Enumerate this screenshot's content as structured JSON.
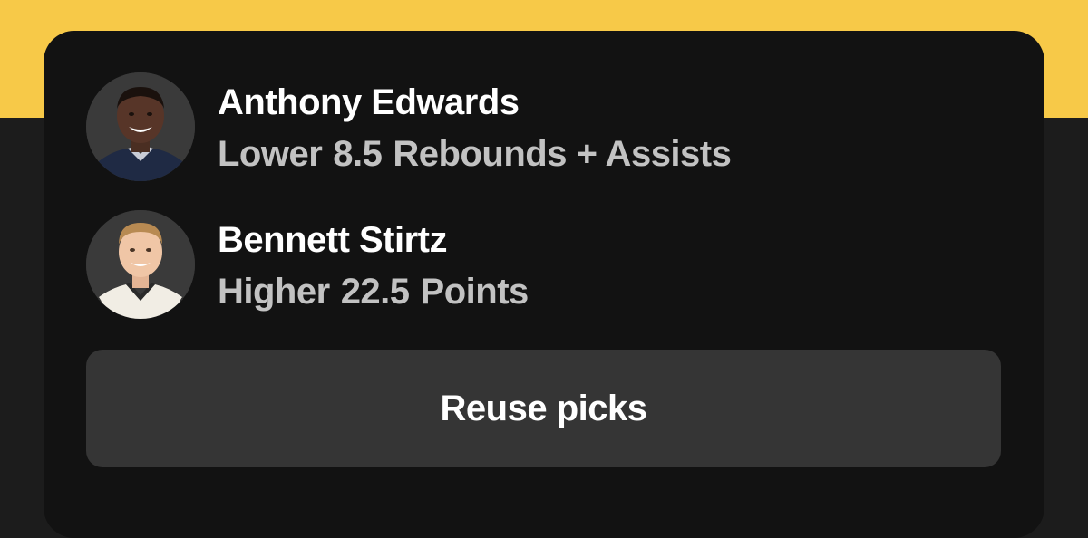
{
  "picks": [
    {
      "player": "Anthony Edwards",
      "direction": "Lower",
      "line": "8.5",
      "stat": "Rebounds + Assists",
      "avatar_icon": "player-headshot-anthony-edwards"
    },
    {
      "player": "Bennett Stirtz",
      "direction": "Higher",
      "line": "22.5",
      "stat": "Points",
      "avatar_icon": "player-headshot-bennett-stirtz"
    }
  ],
  "reuse_button_label": "Reuse picks",
  "colors": {
    "accent_yellow": "#f7c948",
    "page_background": "#1c1c1c",
    "card_background": "#121212",
    "button_background": "#353535",
    "primary_text": "#ffffff",
    "secondary_text": "#c2c2c2"
  }
}
